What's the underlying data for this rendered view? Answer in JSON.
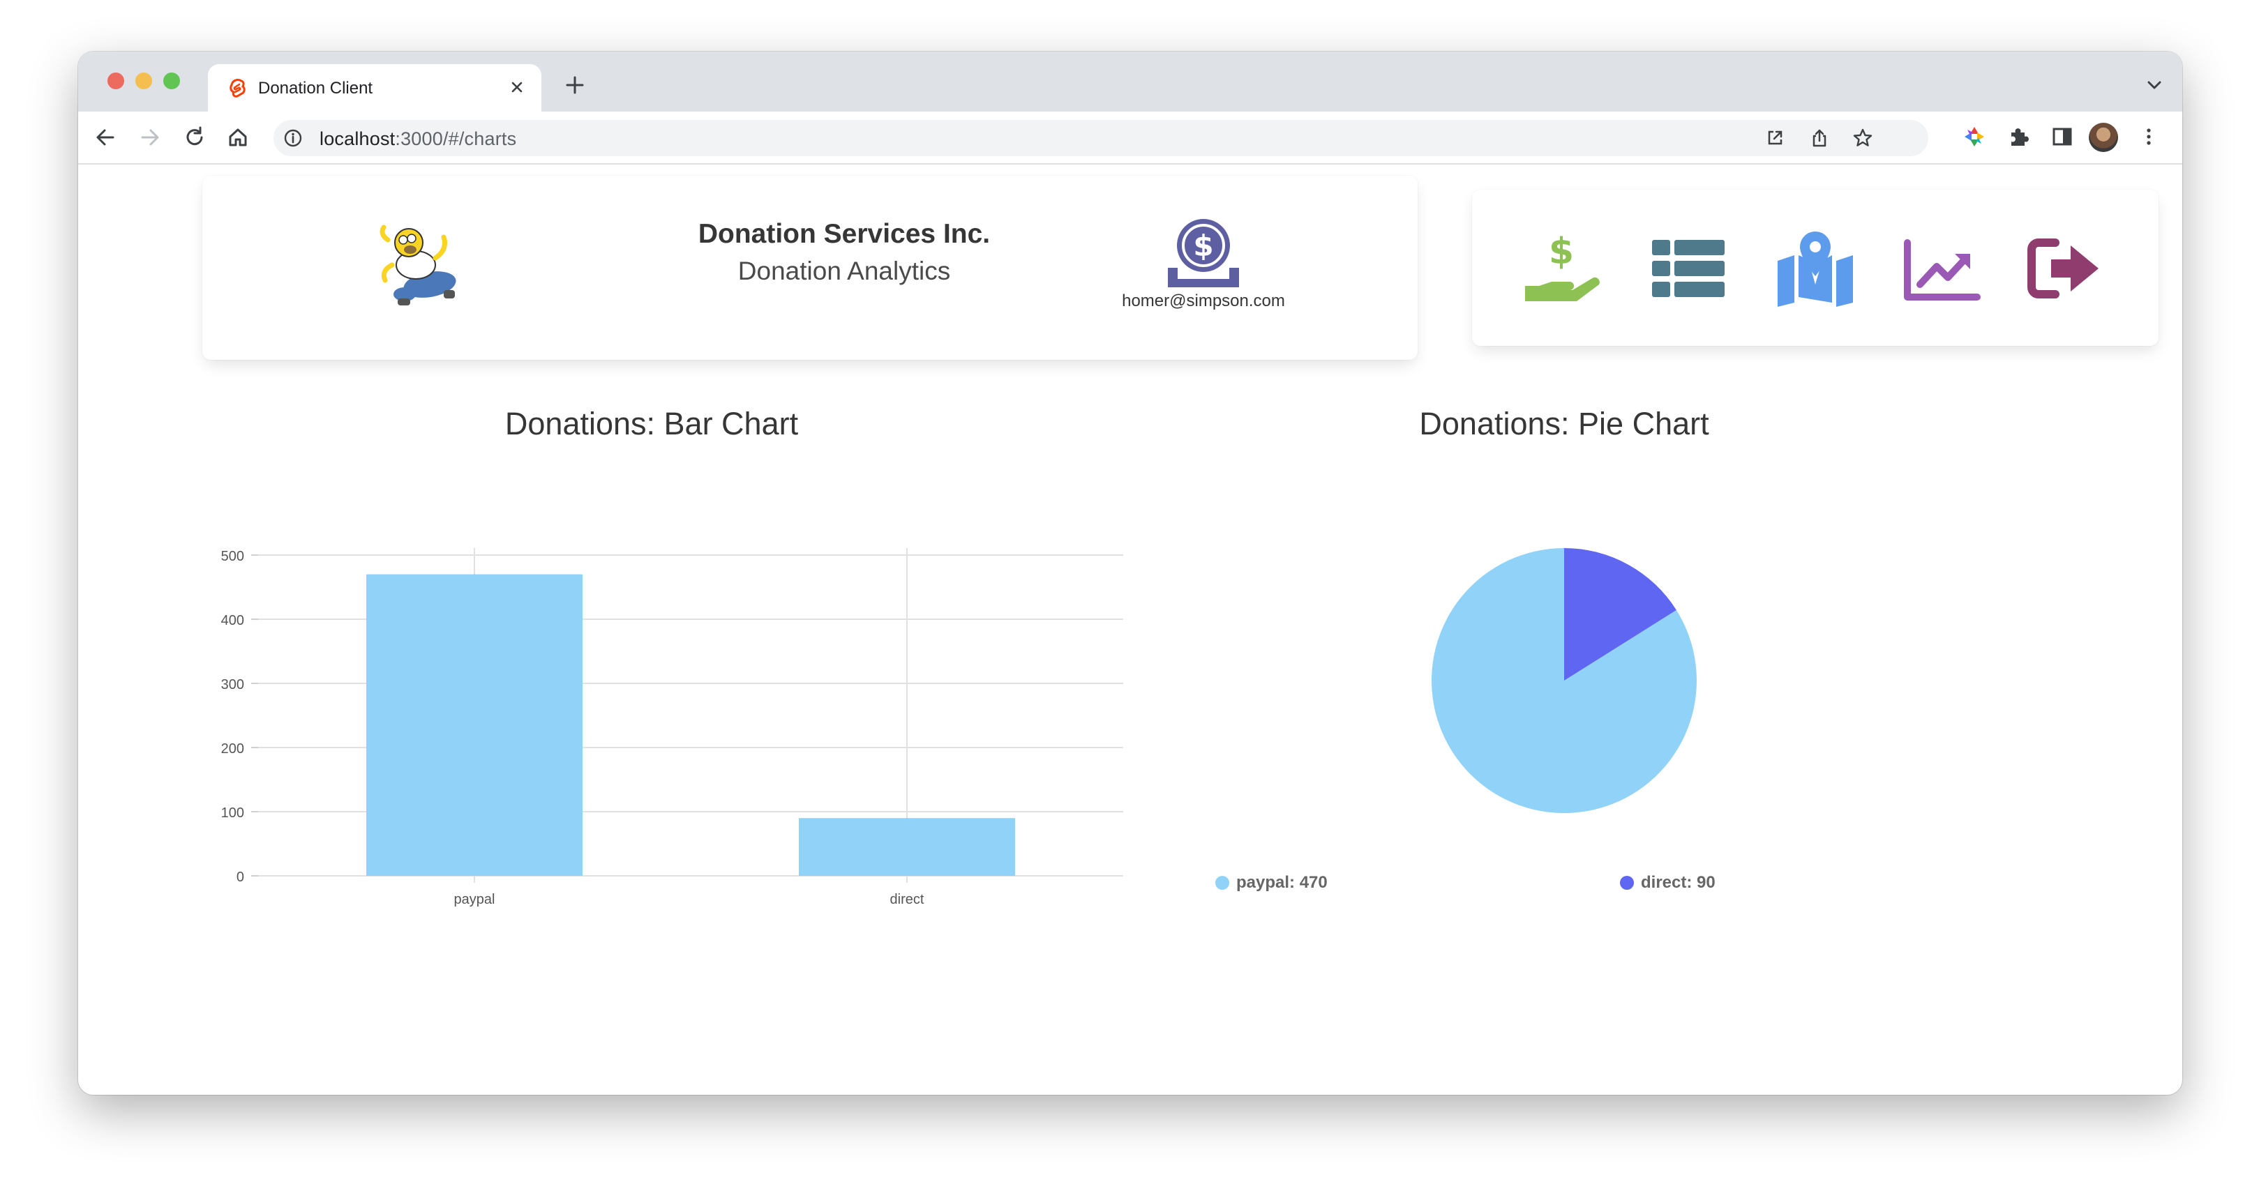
{
  "browser": {
    "tab_title": "Donation Client",
    "url_host": "localhost",
    "url_rest": ":3000/#/charts"
  },
  "header": {
    "company": "Donation Services Inc.",
    "subtitle": "Donation Analytics",
    "user_email": "homer@simpson.com"
  },
  "nav": {
    "items": [
      {
        "icon": "donate-icon",
        "color": "#8dc153"
      },
      {
        "icon": "list-icon",
        "color": "#4f7a8c"
      },
      {
        "icon": "map-icon",
        "color": "#5d9cec"
      },
      {
        "icon": "chart-line-icon",
        "color": "#9b59b6"
      },
      {
        "icon": "sign-out-icon",
        "color": "#8e3d6e"
      }
    ]
  },
  "colors": {
    "paypal": "#91d3f8",
    "direct": "#5f66f2",
    "brand": "#5e5fa3"
  },
  "bar_chart": {
    "heading": "Donations: Bar Chart"
  },
  "pie_chart": {
    "heading": "Donations: Pie Chart",
    "legend": [
      {
        "label": "paypal: 470"
      },
      {
        "label": "direct: 90"
      }
    ]
  },
  "chart_data": [
    {
      "type": "bar",
      "title": "Donations: Bar Chart",
      "categories": [
        "paypal",
        "direct"
      ],
      "values": [
        470,
        90
      ],
      "ylim": [
        0,
        500
      ],
      "yticks": [
        0,
        100,
        200,
        300,
        400,
        500
      ],
      "grid": true,
      "xlabel": "",
      "ylabel": ""
    },
    {
      "type": "pie",
      "title": "Donations: Pie Chart",
      "labels": [
        "paypal",
        "direct"
      ],
      "values": [
        470,
        90
      ],
      "legend": "bottom"
    }
  ]
}
